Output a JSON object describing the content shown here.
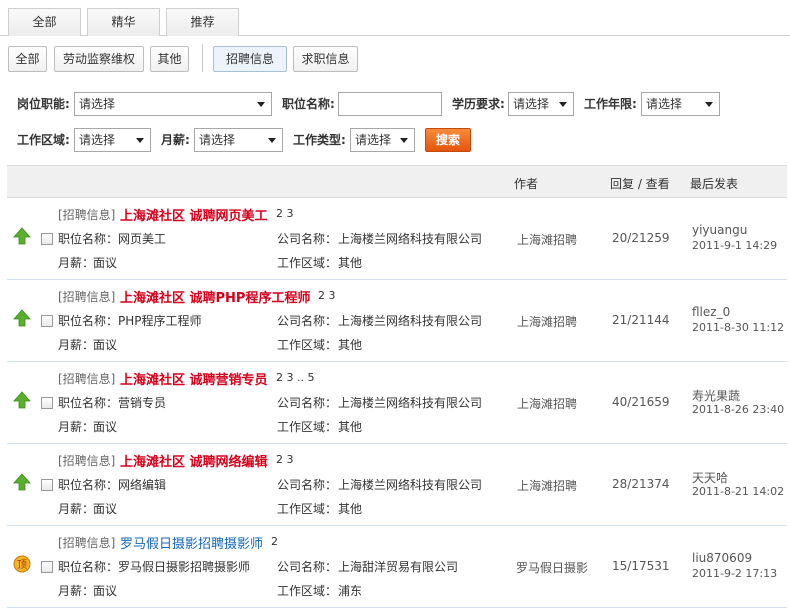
{
  "top_tabs": [
    "全部",
    "精华",
    "推荐"
  ],
  "filter_buttons": [
    "全部",
    "劳动监察维权",
    "其他",
    "招聘信息",
    "求职信息"
  ],
  "form": {
    "position_func_label": "岗位职能:",
    "position_func_value": "请选择",
    "position_name_label": "职位名称:",
    "position_name_value": "",
    "education_label": "学历要求:",
    "education_value": "请选择",
    "years_label": "工作年限:",
    "years_value": "请选择",
    "area_label": "工作区域:",
    "area_value": "请选择",
    "salary_label": "月薪:",
    "salary_value": "请选择",
    "jobtype_label": "工作类型:",
    "jobtype_value": "请选择",
    "search_label": "搜索"
  },
  "table_header": {
    "author": "作者",
    "stats": "回复 / 查看",
    "last": "最后发表"
  },
  "rows": [
    {
      "tag": "[招聘信息]",
      "title": "上海滩社区 诚聘网页美工",
      "pages": "2  3",
      "pos_label": "职位名称：",
      "pos_value": "网页美工",
      "company_label": "公司名称：",
      "company_value": "上海楼兰网络科技有限公司",
      "salary_label": "月薪：",
      "salary_value": "面议",
      "area_label": "工作区域：",
      "area_value": "其他",
      "author": "上海滩招聘",
      "stats": "20/21259",
      "last_user": "yiyuangu",
      "last_date": "2011-9-1 14:29",
      "icon": "up-arrow-icon"
    },
    {
      "tag": "[招聘信息]",
      "title": "上海滩社区 诚聘PHP程序工程师",
      "pages": "2  3",
      "pos_label": "职位名称：",
      "pos_value": "PHP程序工程师",
      "company_label": "公司名称：",
      "company_value": "上海楼兰网络科技有限公司",
      "salary_label": "月薪：",
      "salary_value": "面议",
      "area_label": "工作区域：",
      "area_value": "其他",
      "author": "上海滩招聘",
      "stats": "21/21144",
      "last_user": "fllez_0",
      "last_date": "2011-8-30 11:12",
      "icon": "up-arrow-icon"
    },
    {
      "tag": "[招聘信息]",
      "title": "上海滩社区 诚聘营销专员",
      "pages": "2  3 .. 5",
      "pos_label": "职位名称：",
      "pos_value": "营销专员",
      "company_label": "公司名称：",
      "company_value": "上海楼兰网络科技有限公司",
      "salary_label": "月薪：",
      "salary_value": "面议",
      "area_label": "工作区域：",
      "area_value": "其他",
      "author": "上海滩招聘",
      "stats": "40/21659",
      "last_user": "寿光果蔬",
      "last_date": "2011-8-26 23:40",
      "icon": "up-arrow-icon"
    },
    {
      "tag": "[招聘信息]",
      "title": "上海滩社区 诚聘网络编辑",
      "pages": "2  3",
      "pos_label": "职位名称：",
      "pos_value": "网络编辑",
      "company_label": "公司名称：",
      "company_value": "上海楼兰网络科技有限公司",
      "salary_label": "月薪：",
      "salary_value": "面议",
      "area_label": "工作区域：",
      "area_value": "其他",
      "author": "上海滩招聘",
      "stats": "28/21374",
      "last_user": "天天哈",
      "last_date": "2011-8-21 14:02",
      "icon": "up-arrow-icon"
    },
    {
      "tag": "[招聘信息]",
      "title": "罗马假日摄影招聘摄影师",
      "pages": "2",
      "pos_label": "职位名称：",
      "pos_value": "罗马假日摄影招聘摄影师",
      "company_label": "公司名称：",
      "company_value": "上海甜洋贸易有限公司",
      "salary_label": "月薪：",
      "salary_value": "面议",
      "area_label": "工作区域：",
      "area_value": "浦东",
      "author": "罗马假日摄影",
      "stats": "15/17531",
      "last_user": "liu870609",
      "last_date": "2011-9-2 17:13",
      "icon": "top-badge-icon",
      "top_badge_char": "顶"
    }
  ],
  "colors": {
    "title_red": "#d6001c",
    "title_blue": "#1567b8",
    "search_orange": "#e4550e",
    "up_green": "#58b02c"
  }
}
